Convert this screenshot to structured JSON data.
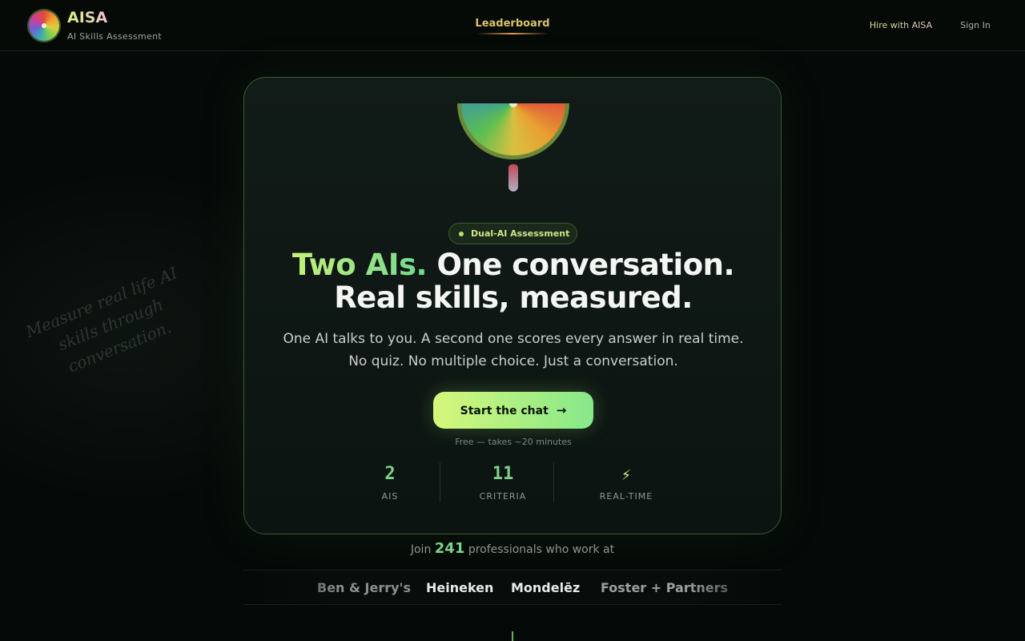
{
  "header": {
    "brand_name": "AISA",
    "brand_sub": "AI Skills Assessment",
    "nav_leaderboard": "Leaderboard",
    "nav_hire": "Hire with AISA",
    "nav_signin": "Sign In"
  },
  "side_text": "Measure real life AI skills through conversation.",
  "hero": {
    "badge": "Dual-AI Assessment",
    "headline_accent": "Two AIs.",
    "headline_rest": "One conversation.",
    "headline_line2": "Real skills, measured.",
    "sub_line1": "One AI talks to you. A second one scores every answer in real time.",
    "sub_line2": "No quiz. No multiple choice. Just a conversation.",
    "cta_label": "Start the chat",
    "cta_arrow": "→",
    "cta_note": "Free — takes ~20 minutes"
  },
  "stats": [
    {
      "value": "2",
      "label": "AIS"
    },
    {
      "value": "11",
      "label": "CRITERIA"
    },
    {
      "value": "⚡",
      "label": "REAL-TIME"
    }
  ],
  "join": {
    "prefix": "Join",
    "count": "241",
    "suffix": "professionals who work at"
  },
  "companies": [
    "Ben & Jerry's",
    "Heineken",
    "Mondelēz",
    "Foster + Partners"
  ],
  "colors": {
    "accent_green": "#7ed08a",
    "accent_lime": "#d6f77a",
    "background": "#050a08",
    "card_border": "#3a5a30"
  },
  "icons": {
    "brand_logo": "citrus-slice-logo",
    "cta_arrow": "arrow-right-icon",
    "realtime": "lightning-icon"
  }
}
